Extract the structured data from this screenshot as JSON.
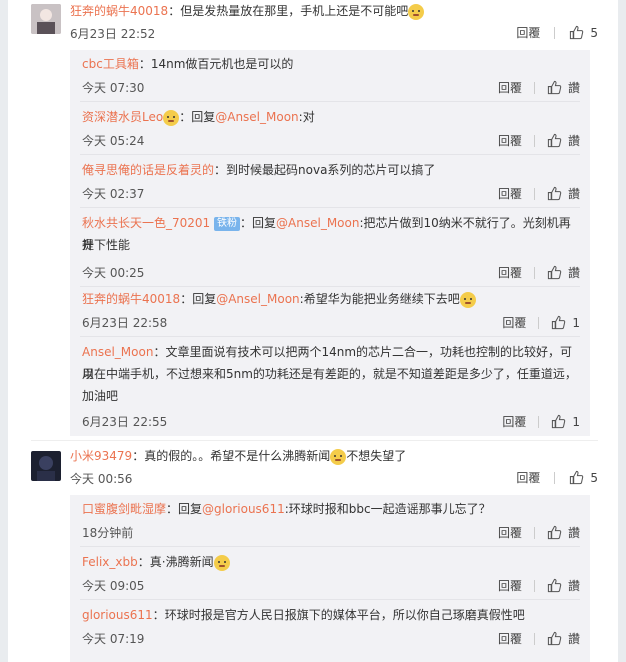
{
  "comments": [
    {
      "user": "狂奔的蜗牛40018",
      "sep": "：",
      "text": "但是发热量放在那里，手机上还是不可能吧",
      "time": "6月23日 22:52",
      "reply_label": "回覆",
      "likes": "5",
      "replies": [
        {
          "user": "cbc工具箱",
          "sep": "：",
          "text": "14nm做百元机也是可以的",
          "time": "今天 07:30",
          "reply_label": "回覆",
          "likes": "讚"
        },
        {
          "user": "资深潜水员Leo",
          "sep": "：",
          "prefix": "回复",
          "mention": "@Ansel_Moon",
          "text": ":对",
          "time": "今天 05:24",
          "reply_label": "回覆",
          "likes": "讚"
        },
        {
          "user": "俺寻思俺的话是反着灵的",
          "sep": "：",
          "text": "到时候最起码nova系列的芯片可以搞了",
          "time": "今天 02:37",
          "reply_label": "回覆",
          "likes": "讚"
        },
        {
          "user": "秋水共长天一色_70201",
          "badge": "铁粉",
          "sep": "：",
          "prefix": "回复",
          "mention": "@Ansel_Moon",
          "text": ":把芯片做到10纳米不就行了。光刻机再提",
          "text2": "升下性能",
          "time": "今天 00:25",
          "reply_label": "回覆",
          "likes": "讚"
        },
        {
          "user": "狂奔的蜗牛40018",
          "sep": "：",
          "prefix": "回复",
          "mention": "@Ansel_Moon",
          "text": ":希望华为能把业务继续下去吧",
          "time": "6月23日 22:58",
          "reply_label": "回覆",
          "likes": "1"
        },
        {
          "user": "Ansel_Moon",
          "sep": "：",
          "text": "文章里面说有技术可以把两个14nm的芯片二合一，功耗也控制的比较好，可以",
          "text2": "用在中端手机，不过想来和5nm的功耗还是有差距的，就是不知道差距是多少了，任重道远，",
          "text3": "加油吧",
          "time": "6月23日 22:55",
          "reply_label": "回覆",
          "likes": "1"
        }
      ]
    },
    {
      "user": "小米93479",
      "sep": "：",
      "text": "真的假的。。希望不是什么沸腾新闻",
      "text_after": "不想失望了",
      "time": "今天 00:56",
      "reply_label": "回覆",
      "likes": "5",
      "replies": [
        {
          "user": "口蜜腹剑毗湿摩",
          "sep": "：",
          "prefix": "回复",
          "mention": "@glorious611",
          "text": ":环球时报和bbc一起造谣那事儿忘了？",
          "time": "18分钟前",
          "reply_label": "回覆",
          "likes": "讚"
        },
        {
          "user": "Felix_xbb",
          "sep": "：",
          "text": "真·沸腾新闻",
          "time": "今天 09:05",
          "reply_label": "回覆",
          "likes": "讚"
        },
        {
          "user": "glorious611",
          "sep": "：",
          "text": "环球时报是官方人民日报旗下的媒体平台，所以你自己琢磨真假性吧",
          "time": "今天 07:19",
          "reply_label": "回覆",
          "likes": "讚"
        }
      ]
    }
  ]
}
